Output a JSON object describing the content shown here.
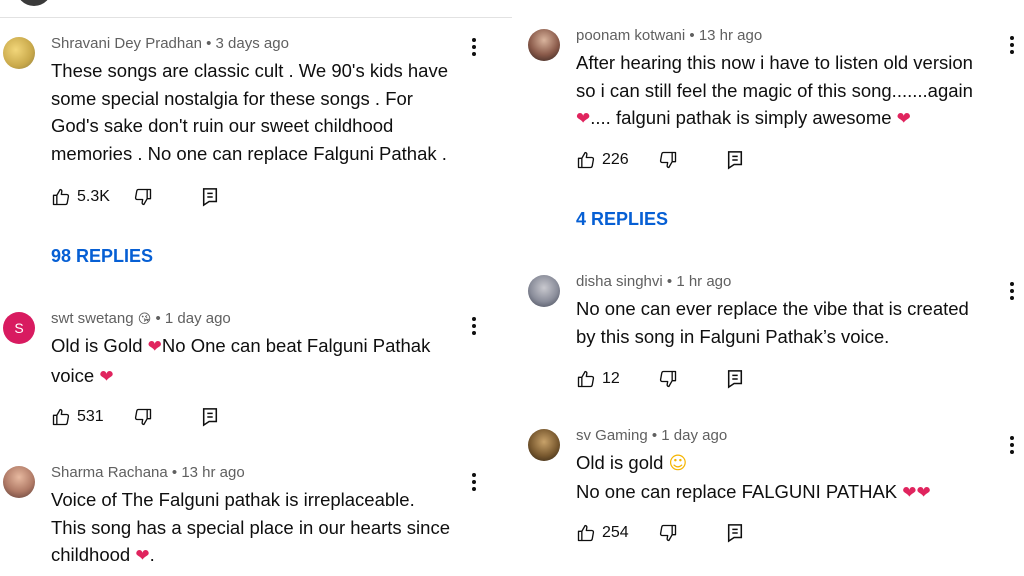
{
  "left": {
    "comments": [
      {
        "author": "Shravani Dey Pradhan",
        "time": "3 days ago",
        "lines": [
          "These songs are classic cult  . We 90's kids have",
          "some special nostalgia for these songs   . For",
          "God's sake don't ruin our sweet childhood",
          "memories   . No one can replace Falguni Pathak  ."
        ],
        "likes": "5.3K",
        "replies_label": "98 REPLIES"
      },
      {
        "author": "swt swetang",
        "author_emoji": "😘",
        "time": "1 day ago",
        "avatar_letter": "S",
        "line1_a": "Old is Gold ",
        "line1_b": "No One  can beat   Falguni Pathak",
        "line2_a": "voice ",
        "likes": "531"
      },
      {
        "author": "Sharma Rachana",
        "time": "13 hr ago",
        "lines": [
          "Voice of The Falguni pathak is irreplaceable.",
          "This song has a special place in our hearts since"
        ],
        "line3_a": "childhood ",
        "line3_b": "."
      }
    ]
  },
  "right": {
    "comments": [
      {
        "author": "poonam kotwani",
        "time": "13 hr ago",
        "line1": "After hearing this now i have to listen old version",
        "line2": "so i can still feel the magic of this song.......again",
        "line3_b": ".... falguni pathak is simply awesome ",
        "likes": "226",
        "replies_label": "4 REPLIES"
      },
      {
        "author": "disha singhvi",
        "time": "1 hr ago",
        "lines": [
          "No one can ever replace the vibe that is created",
          "by this song in Falguni Pathak’s voice."
        ],
        "likes": "12"
      },
      {
        "author": "sv Gaming",
        "time": "1 day ago",
        "line1_a": "Old is gold ",
        "line2_a": "No one can replace FALGUNI PATHAK ",
        "likes": "254"
      }
    ]
  },
  "separator": " • ",
  "icons": {
    "like": "thumbs-up-icon",
    "dislike": "thumbs-down-icon",
    "reply": "reply-icon",
    "more": "more-vert-icon",
    "heart": "red-heart-emoji",
    "smile": "smiling-face-emoji"
  },
  "colors": {
    "link": "#065fd4",
    "meta": "#606060",
    "heart": "#e0245e"
  }
}
